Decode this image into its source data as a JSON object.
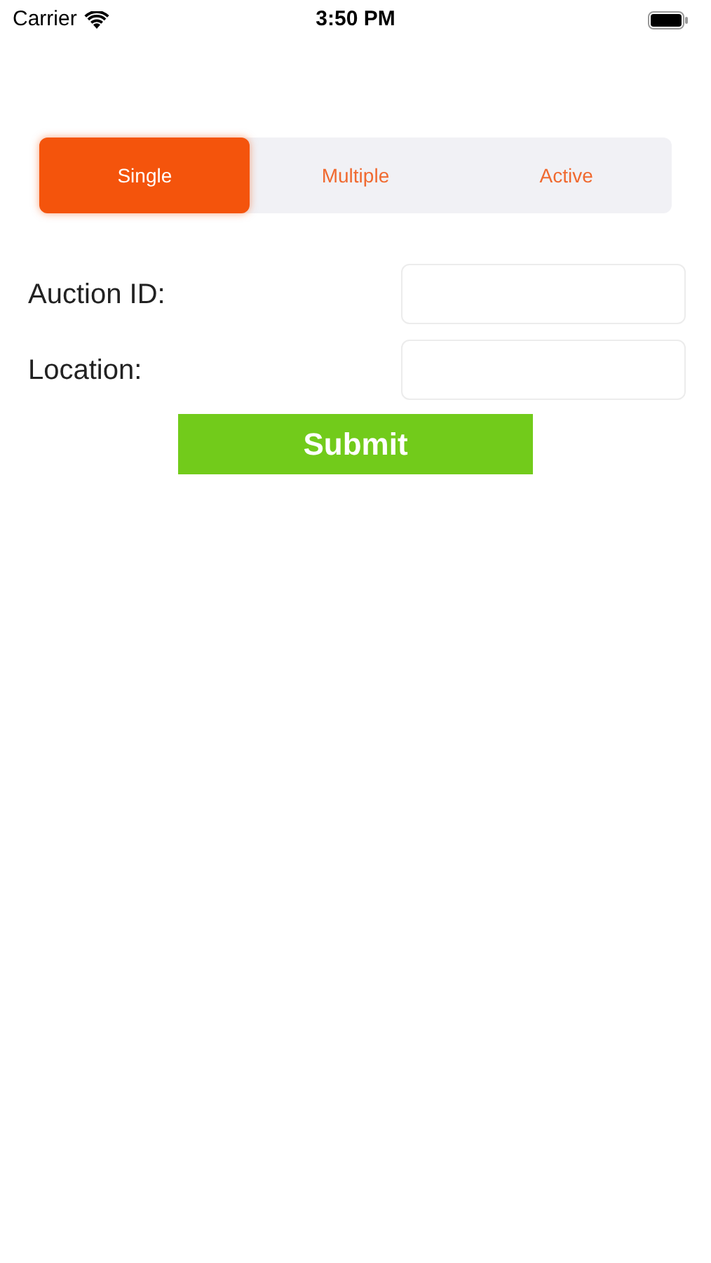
{
  "status_bar": {
    "carrier": "Carrier",
    "time": "3:50 PM"
  },
  "tabs": [
    {
      "label": "Single",
      "selected": true
    },
    {
      "label": "Multiple",
      "selected": false
    },
    {
      "label": "Active",
      "selected": false
    }
  ],
  "fields": [
    {
      "label": "Auction ID:"
    },
    {
      "label": "Location:"
    }
  ],
  "submit": "Submit"
}
